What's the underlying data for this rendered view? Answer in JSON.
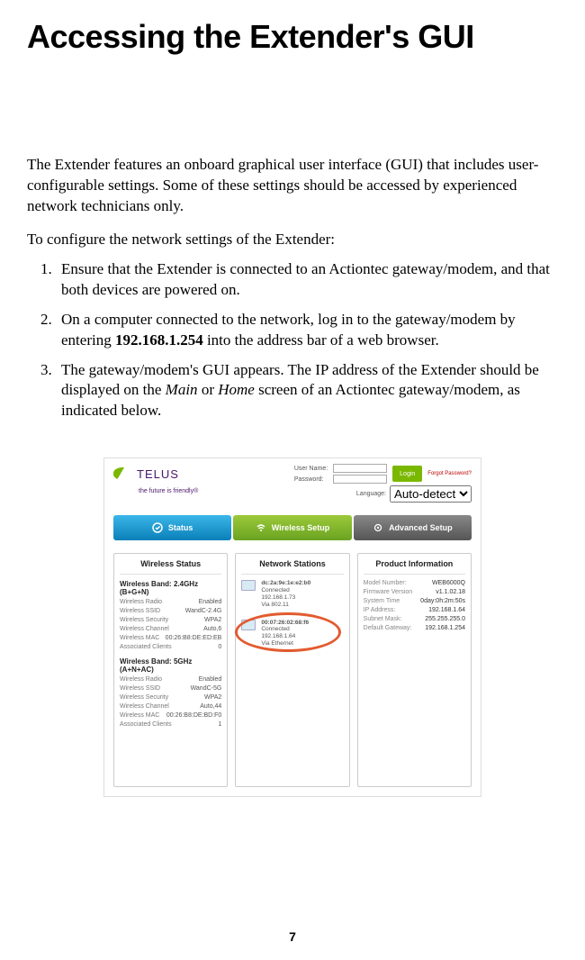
{
  "page": {
    "title": "Accessing the Extender's GUI",
    "number": "7"
  },
  "intro": "The Extender features an onboard graphical user interface (GUI) that includes user-configurable settings. Some of these settings should be accessed by experienced network technicians only.",
  "lead": "To configure the network settings of the Extender:",
  "steps": {
    "s1": "Ensure that the Extender is connected to an Actiontec gateway/modem, and that both devices are powered on.",
    "s2a": "On a computer connected to the network, log in to the gateway/modem by entering ",
    "s2ip": "192.168.1.254",
    "s2b": " into the address bar of a web browser.",
    "s3a": "The gateway/modem's GUI appears. The IP address of the Extender should be displayed on the ",
    "s3main": "Main",
    "s3or": " or ",
    "s3home": "Home",
    "s3b": " screen of an Actiontec gateway/modem, as indicated below."
  },
  "shot": {
    "brand": "TELUS",
    "tagline": "the future is friendly®",
    "login": {
      "username_label": "User Name:",
      "password_label": "Password:",
      "language_label": "Language:",
      "language_value": "Auto-detect",
      "login_btn": "Login",
      "forgot": "Forgot Password?"
    },
    "tabs": {
      "status": "Status",
      "wireless": "Wireless Setup",
      "advanced": "Advanced Setup"
    },
    "panel_wireless": {
      "title": "Wireless Status",
      "band24_title": "Wireless Band: 2.4GHz (B+G+N)",
      "radio_label": "Wireless Radio",
      "radio_value": "Enabled",
      "ssid_label": "Wireless SSID",
      "ssid_value": "WandC-2.4G",
      "sec_label": "Wireless Security",
      "sec_value": "WPA2",
      "chan_label": "Wireless Channel",
      "chan_value": "Auto,6",
      "mac_label": "Wireless MAC",
      "mac_value": "00:26:B8:DE:ED:EB",
      "clients_label": "Associated Clients",
      "clients_value": "0",
      "band5_title": "Wireless Band: 5GHz (A+N+AC)",
      "radio5_value": "Enabled",
      "ssid5_value": "WandC-5G",
      "sec5_value": "WPA2",
      "chan5_value": "Auto,44",
      "mac5_value": "00:26:B8:DE:BD:F0",
      "clients5_value": "1"
    },
    "panel_stations": {
      "title": "Network Stations",
      "st1_mac": "dc:2a:9e:1e:e2:b0",
      "st1_info": "Connected\n192.168.1.73\nVia 802.11",
      "st2_mac": "00:07:26:02:68:f6",
      "st2_info": "Connected\n192.168.1.64\nVia Ethernet"
    },
    "panel_product": {
      "title": "Product Information",
      "model_label": "Model Number:",
      "model_value": "WEB6000Q",
      "fw_label": "Firmware Version",
      "fw_value": "v1.1.02.18",
      "time_label": "System Time",
      "time_value": "0day:0h:2m:50s",
      "ip_label": "IP Address:",
      "ip_value": "192.168.1.64",
      "mask_label": "Subnet Mask:",
      "mask_value": "255.255.255.0",
      "gw_label": "Default Gateway:",
      "gw_value": "192.168.1.254"
    }
  }
}
